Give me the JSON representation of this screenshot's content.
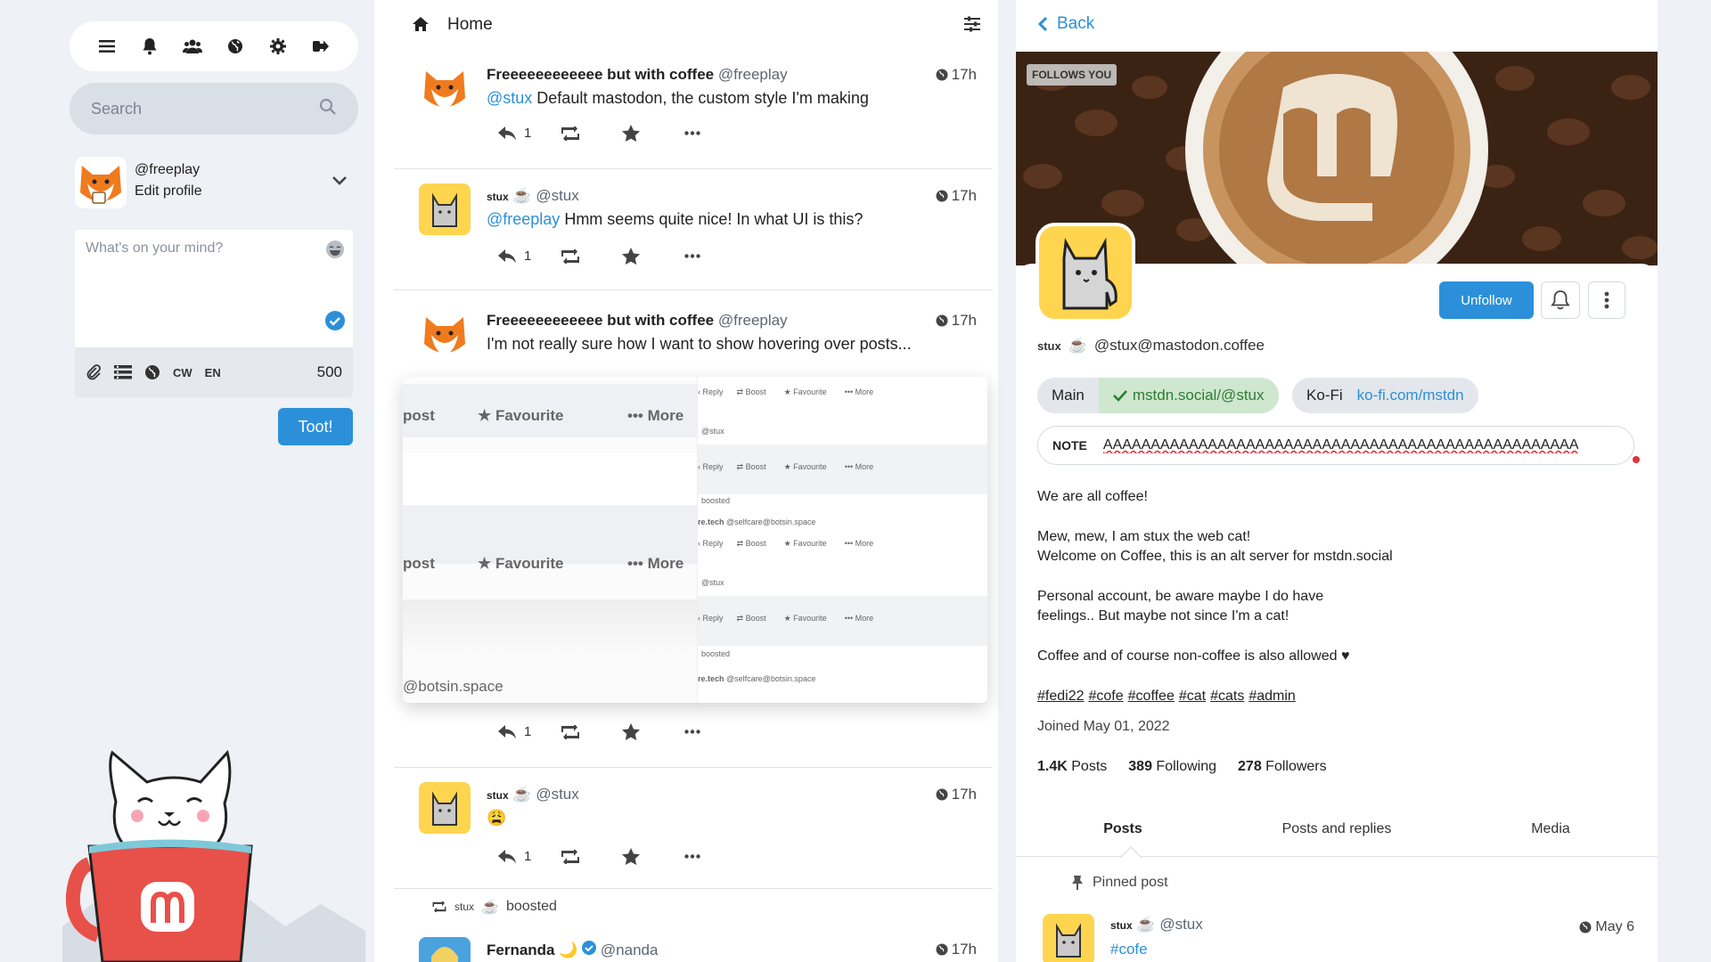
{
  "nav": {
    "items": [
      "menu-icon",
      "bell-icon",
      "people-icon",
      "globe-icon",
      "gear-icon",
      "logout-icon"
    ]
  },
  "search": {
    "placeholder": "Search"
  },
  "me": {
    "handle": "@freeplay",
    "edit_label": "Edit profile"
  },
  "compose": {
    "placeholder": "What's on your mind?",
    "cw_label": "CW",
    "lang_label": "EN",
    "char_count": "500",
    "toot_label": "Toot!"
  },
  "timeline": {
    "title": "Home",
    "statuses": [
      {
        "display_name": "Freeeeeeeeeeee but with coffee",
        "acct": "@freeplay",
        "time": "17h",
        "mention": "@stux",
        "text": " Default mastodon, the custom style I'm making",
        "reply_count": "1"
      },
      {
        "display_name": "stux",
        "display_emoji": "☕",
        "acct": "@stux",
        "time": "17h",
        "mention": "@freeplay",
        "text": " Hmm seems quite nice! In what UI is this?",
        "reply_count": "1"
      },
      {
        "display_name": "Freeeeeeeeeeee but with coffee",
        "acct": "@freeplay",
        "time": "17h",
        "text": "I'm not really sure how I want to show hovering over posts...",
        "reply_count": "1"
      },
      {
        "display_name": "stux",
        "display_emoji": "☕",
        "acct": "@stux",
        "time": "17h",
        "text": "😩",
        "reply_count": "1"
      }
    ],
    "preview": {
      "big_post": "post",
      "big_favourite": "Favourite",
      "big_more": "More",
      "big_domain": "@botsin.space",
      "small_reply": "Reply",
      "small_boost": "Boost",
      "small_favourite": "Favourite",
      "small_more": "More",
      "small_stux": "@stux",
      "small_boosted": "boosted",
      "small_selfcare": "re.tech",
      "small_selfcare_acct": "@selfcare@botsin.space"
    },
    "boosted_row": {
      "name": "stux",
      "emoji": "☕",
      "label": "boosted"
    },
    "last_status": {
      "display_name": "Fernanda",
      "emoji": "🌙",
      "acct": "@nanda",
      "time": "17h"
    }
  },
  "profile": {
    "back_label": "Back",
    "follows_you": "FOLLOWS YOU",
    "unfollow_label": "Unfollow",
    "display_name": "stux",
    "display_emoji": "☕",
    "acct": "@stux@mastodon.coffee",
    "fields": [
      {
        "name": "Main",
        "value": "mstdn.social/@stux",
        "verified": true
      },
      {
        "name": "Ko-Fi",
        "value": "ko-fi.com/mstdn",
        "verified": false
      }
    ],
    "note_label": "NOTE",
    "note_value": "AAAAAAAAAAAAAAAAAAAAAAAAAAAAAAAAAAAAAAAAAAAAAAAAAA",
    "bio": [
      "We are all coffee!",
      "Mew, mew, I am stux the web cat!",
      "Welcome on Coffee, this is an alt server for mstdn.social",
      "Personal account, be aware maybe I do have",
      "feelings.. But maybe not since I'm a cat!",
      "Coffee and of course non-coffee is also allowed ♥"
    ],
    "hashtags": [
      "#fedi22",
      "#cofe",
      "#coffee",
      "#cat",
      "#cats",
      "#admin"
    ],
    "joined": "Joined May 01, 2022",
    "stats": {
      "posts_count": "1.4K",
      "posts_label": "Posts",
      "following_count": "389",
      "following_label": "Following",
      "followers_count": "278",
      "followers_label": "Followers"
    },
    "tabs": [
      "Posts",
      "Posts and replies",
      "Media"
    ],
    "pinned_label": "Pinned post",
    "pinned": {
      "display_name": "stux",
      "display_emoji": "☕",
      "acct": "@stux",
      "time": "May 6",
      "tag": "#cofe"
    }
  },
  "colors": {
    "accent": "#2b90d9",
    "background": "#eef1f5",
    "verified_bg": "#cfe6cf",
    "verified_text": "#2d7d32",
    "heart": "#e0323c"
  }
}
